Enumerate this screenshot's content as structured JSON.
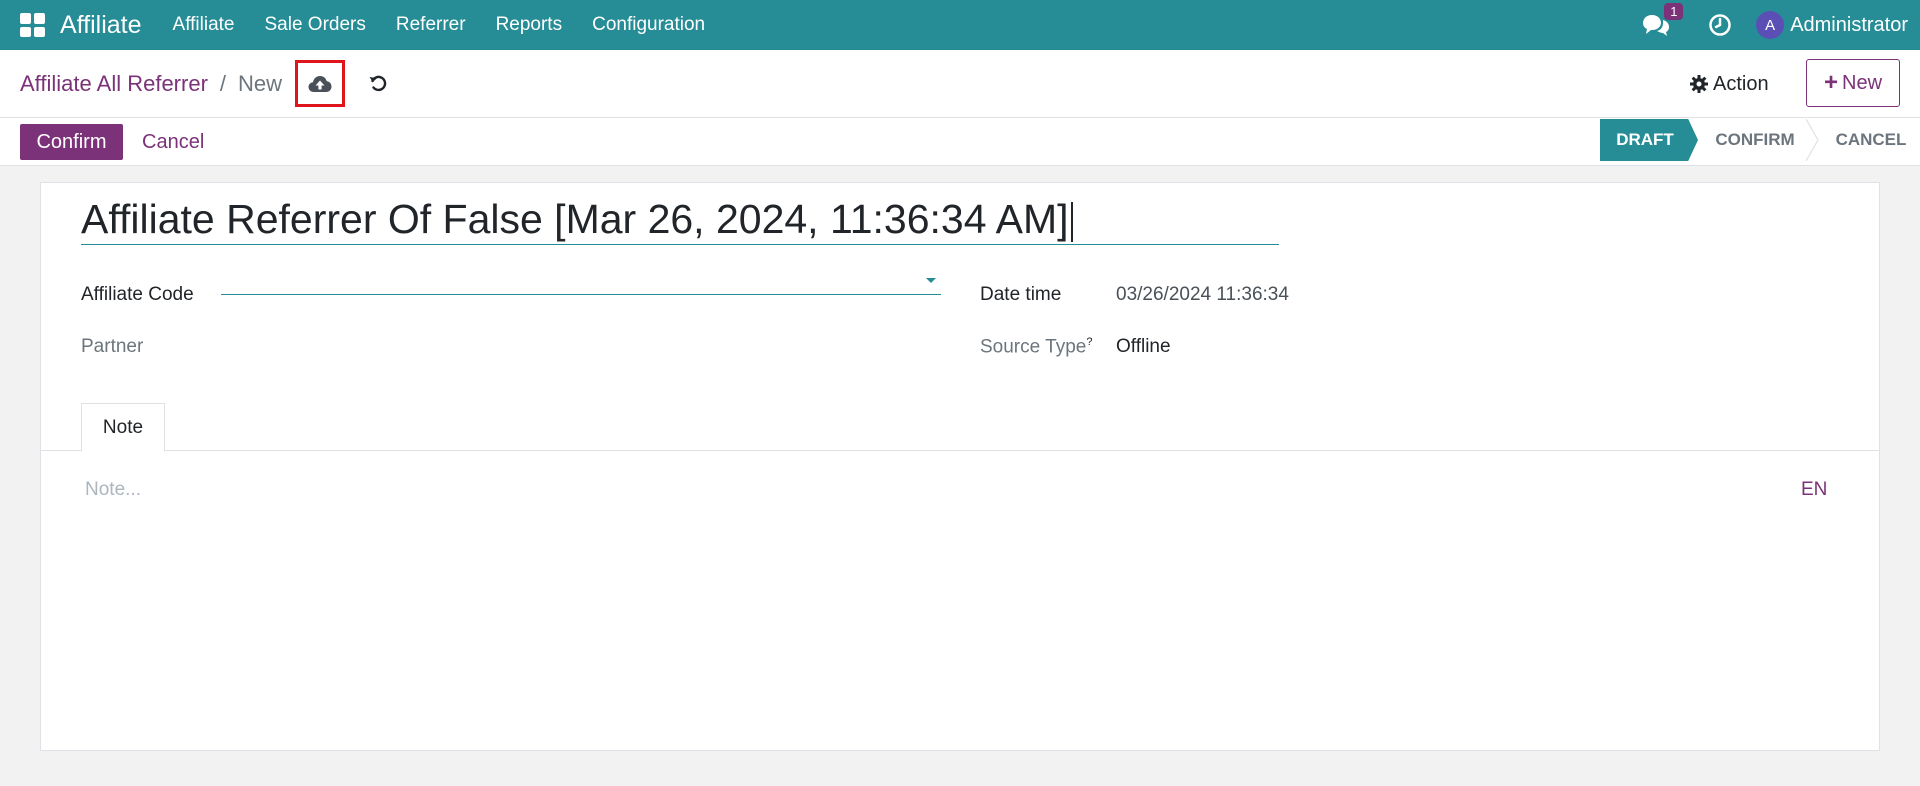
{
  "navbar": {
    "brand": "Affiliate",
    "menu": [
      "Affiliate",
      "Sale Orders",
      "Referrer",
      "Reports",
      "Configuration"
    ],
    "chat_badge": "1",
    "avatar_letter": "A",
    "user": "Administrator",
    "bg_color": "#268c95"
  },
  "breadcrumb": {
    "parent": "Affiliate All Referrer",
    "separator": "/",
    "current": "New"
  },
  "control_panel": {
    "action_label": "Action",
    "new_label": "New",
    "new_plus": "+"
  },
  "statusbar": {
    "confirm_label": "Confirm",
    "cancel_label": "Cancel",
    "stages": [
      "DRAFT",
      "CONFIRM",
      "CANCEL"
    ],
    "active_stage": "DRAFT",
    "accent": "#7b3278"
  },
  "form": {
    "title": "Affiliate Referrer Of False [Mar 26, 2024, 11:36:34 AM]",
    "affiliate_code_label": "Affiliate Code",
    "affiliate_code_value": "",
    "partner_label": "Partner",
    "date_time_label": "Date time",
    "date_time_value": "03/26/2024 11:36:34",
    "source_type_label": "Source Type",
    "source_type_help": "?",
    "source_type_value": "Offline",
    "tab_note": "Note",
    "note_placeholder": "Note...",
    "lang": "EN"
  },
  "icons": {
    "apps": "apps-grid-icon",
    "chat": "chat-icon",
    "clock": "clock-icon",
    "save": "cloud-upload-icon",
    "discard": "undo-icon",
    "gear": "gear-icon"
  }
}
